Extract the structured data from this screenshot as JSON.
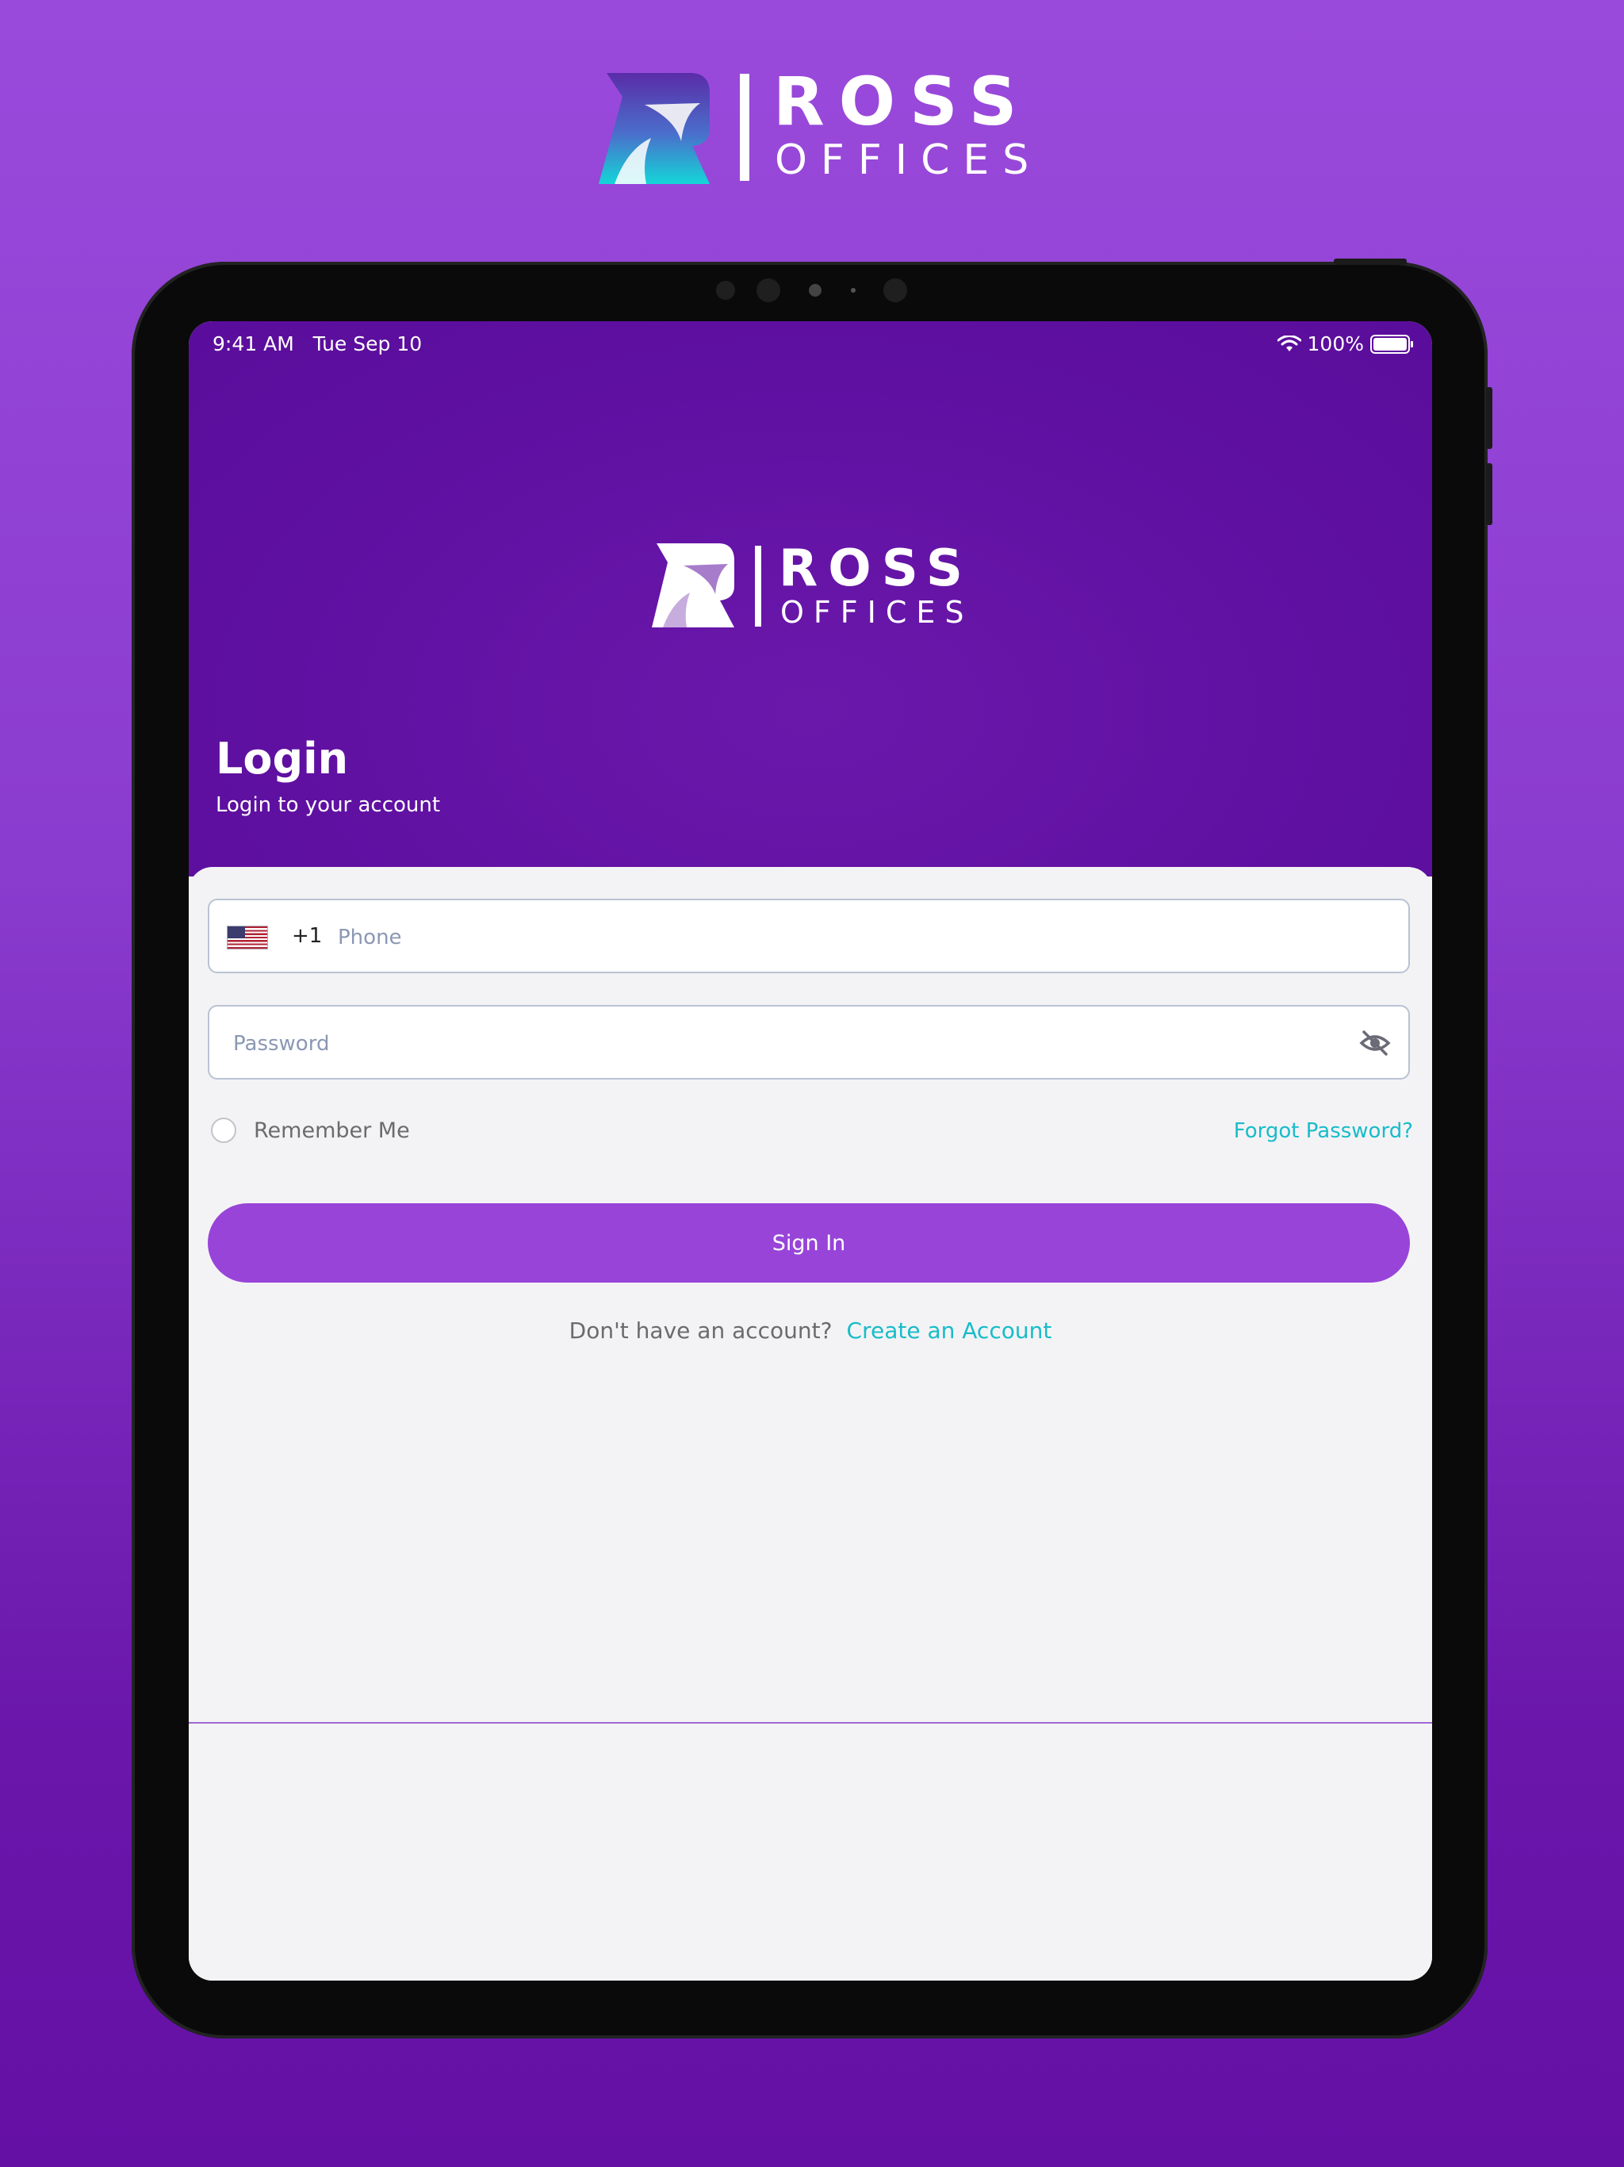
{
  "brand": {
    "name_line1": "ROSS",
    "name_line2": "OFFICES"
  },
  "status_bar": {
    "time": "9:41 AM",
    "date": "Tue Sep 10",
    "battery": "100%"
  },
  "header": {
    "title": "Login",
    "subtitle": "Login to your account"
  },
  "phone_field": {
    "country_code": "+1",
    "placeholder": "Phone",
    "value": ""
  },
  "password_field": {
    "placeholder": "Password",
    "value": ""
  },
  "remember_me": {
    "label": "Remember Me",
    "checked": false
  },
  "forgot_password": "Forgot Password?",
  "sign_in_label": "Sign In",
  "signup_prompt": {
    "question": "Don't have an account?",
    "link": "Create an Account"
  },
  "colors": {
    "primary": "#9844d8",
    "header_bg": "#5f10a1",
    "link": "#18bcc9",
    "page_bg_top": "#9a4adb",
    "page_bg_bottom": "#6510a5"
  }
}
